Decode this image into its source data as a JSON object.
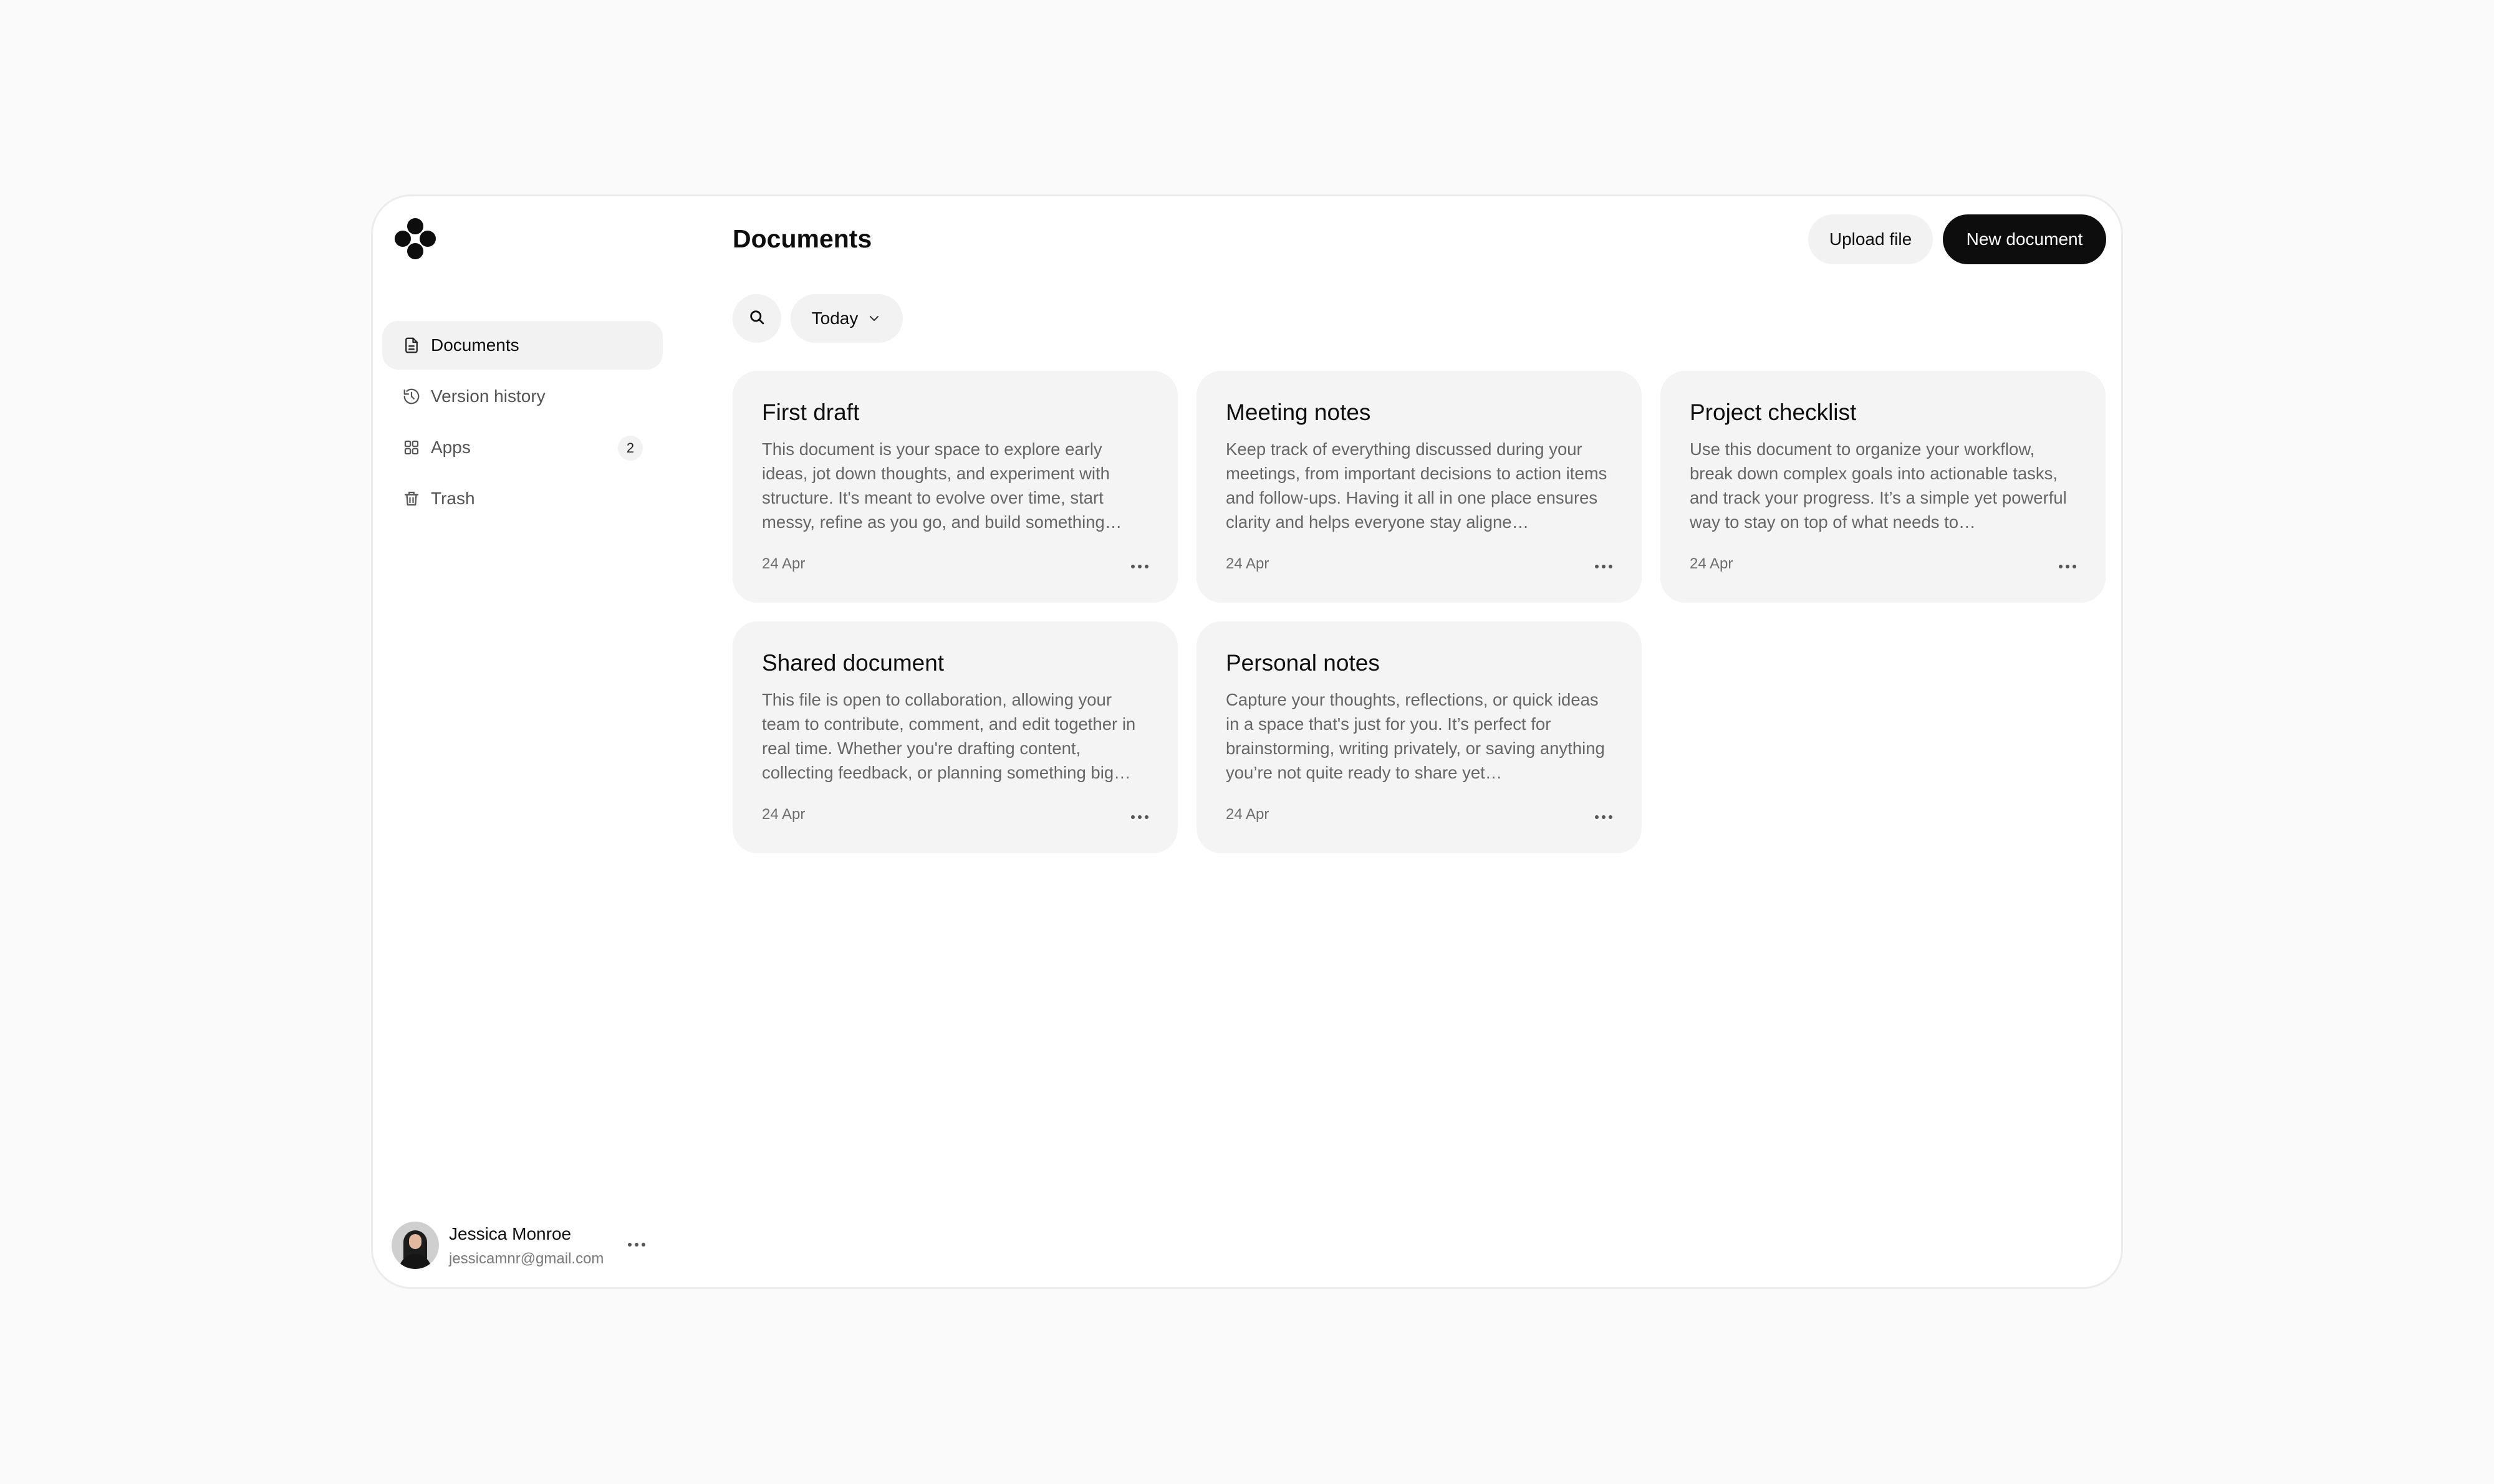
{
  "sidebar": {
    "nav": [
      {
        "label": "Documents",
        "icon": "document-icon",
        "active": true
      },
      {
        "label": "Version history",
        "icon": "history-icon"
      },
      {
        "label": "Apps",
        "icon": "apps-icon",
        "badge": "2"
      },
      {
        "label": "Trash",
        "icon": "trash-icon"
      }
    ],
    "user": {
      "name": "Jessica Monroe",
      "email": "jessicamnr@gmail.com"
    }
  },
  "header": {
    "title": "Documents",
    "upload_label": "Upload file",
    "new_label": "New document"
  },
  "filters": {
    "date_label": "Today"
  },
  "cards": [
    {
      "title": "First draft",
      "description": "This document is your space to explore early ideas, jot down thoughts, and experiment with structure. It's meant to evolve over time, start messy, refine as you go, and build something…",
      "date": "24 Apr"
    },
    {
      "title": "Meeting notes",
      "description": "Keep track of everything discussed during your meetings, from important decisions to action items and follow-ups. Having it all in one place ensures clarity and helps everyone stay aligne…",
      "date": "24 Apr"
    },
    {
      "title": "Project checklist",
      "description": "Use this document to organize your workflow, break down complex goals into actionable tasks, and track your progress. It’s a simple yet powerful way to stay on top of what needs to…",
      "date": "24 Apr"
    },
    {
      "title": "Shared document",
      "description": "This file is open to collaboration, allowing your team to contribute, comment, and edit together in real time. Whether you're drafting content, collecting feedback, or planning something big…",
      "date": "24 Apr"
    },
    {
      "title": "Personal notes",
      "description": "Capture your thoughts, reflections, or quick ideas in a space that's just for you. It’s perfect for brainstorming, writing privately, or saving anything you’re not quite ready to share yet…",
      "date": "24 Apr"
    }
  ],
  "colors": {
    "accent": "#0d0d0d",
    "surface": "#f4f4f4",
    "background": "#fafafa"
  }
}
